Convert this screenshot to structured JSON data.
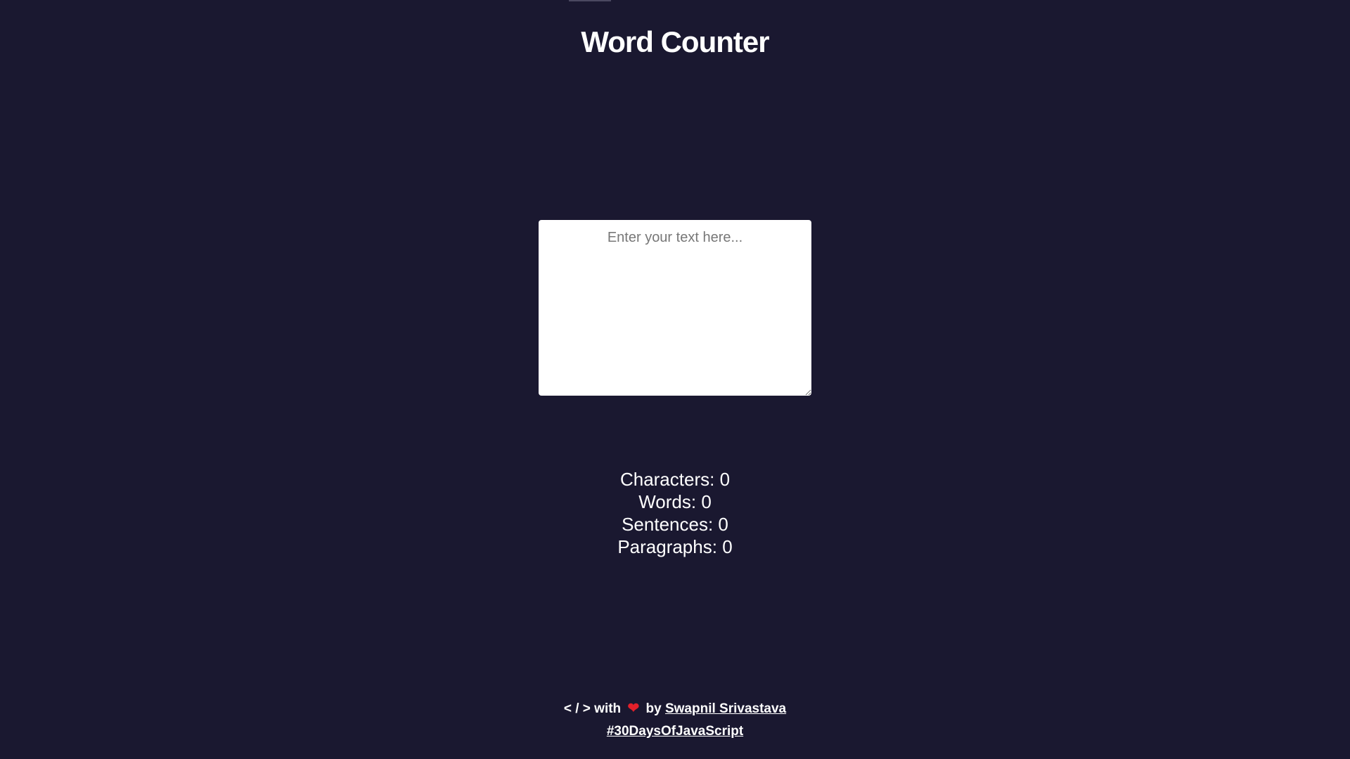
{
  "header": {
    "title": "Word Counter"
  },
  "editor": {
    "placeholder": "Enter your text here...",
    "value": ""
  },
  "stats": {
    "characters_label": "Characters:",
    "characters_value": "0",
    "words_label": "Words:",
    "words_value": "0",
    "sentences_label": "Sentences:",
    "sentences_value": "0",
    "paragraphs_label": "Paragraphs:",
    "paragraphs_value": "0"
  },
  "footer": {
    "code_symbol": "< / >",
    "with_text": "with",
    "heart_icon": "❤",
    "by_text": "by",
    "author_link": "Swapnil Srivastava",
    "hashtag_link": "#30DaysOfJavaScript"
  },
  "colors": {
    "background": "#1a1830",
    "text": "#ffffff",
    "heart": "#e3202a"
  }
}
